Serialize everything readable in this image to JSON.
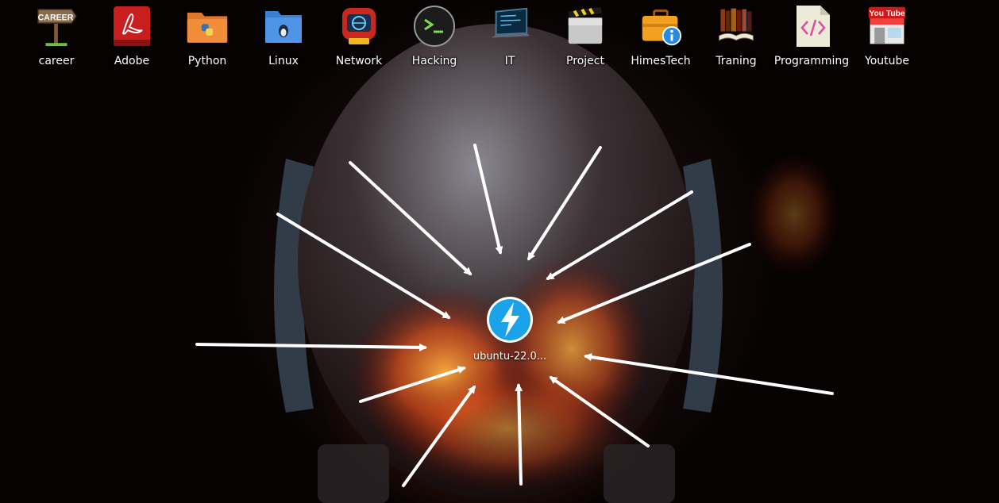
{
  "desktop": {
    "icons": [
      {
        "label": "career",
        "sign_text": "CAREER",
        "icon": "career-signpost-icon"
      },
      {
        "label": "Adobe",
        "icon": "adobe-acrobat-icon"
      },
      {
        "label": "Python",
        "icon": "python-folder-icon"
      },
      {
        "label": "Linux",
        "icon": "linux-folder-icon"
      },
      {
        "label": "Network",
        "icon": "network-robot-icon"
      },
      {
        "label": "Hacking",
        "icon": "terminal-icon"
      },
      {
        "label": "IT",
        "icon": "laptop-terminal-icon"
      },
      {
        "label": "Project",
        "icon": "clapper-folder-icon"
      },
      {
        "label": "HimesTech",
        "icon": "briefcase-info-icon"
      },
      {
        "label": "Traning",
        "icon": "books-icon"
      },
      {
        "label": "Programming",
        "icon": "code-file-icon"
      },
      {
        "label": "Youtube",
        "sign_text": "You Tube",
        "icon": "youtube-store-icon"
      }
    ],
    "center_file": {
      "label": "ubuntu-22.0...",
      "icon": "lightning-app-icon"
    }
  },
  "colors": {
    "label_text": "#ffffff",
    "arrow": "#ffffff",
    "lightning_bg": "#1aa3e8"
  }
}
